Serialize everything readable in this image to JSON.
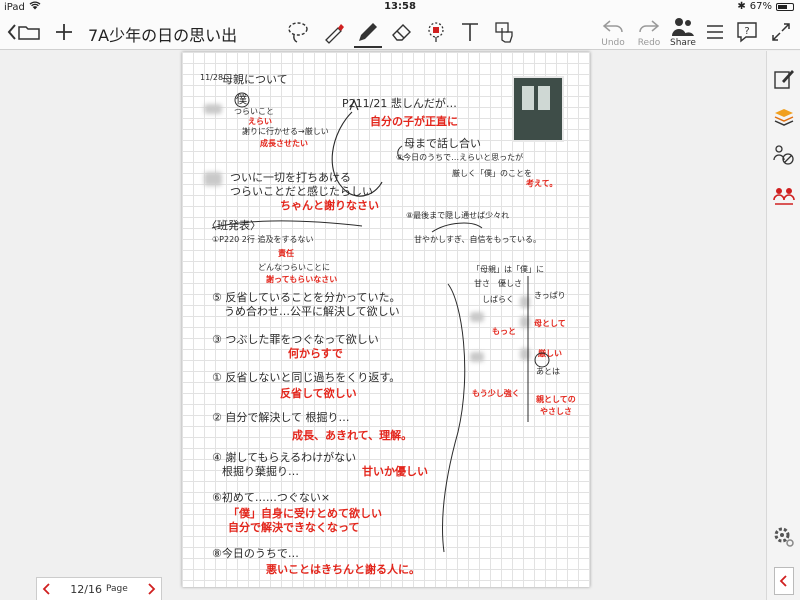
{
  "status": {
    "device": "iPad",
    "time": "13:58",
    "battery": "67%",
    "battery_level": 0.67
  },
  "toolbar": {
    "title": "7A少年の日の思い出",
    "undo_label": "Undo",
    "redo_label": "Redo",
    "share_label": "Share"
  },
  "pagenav": {
    "current": "12/16",
    "label": "Page"
  },
  "note": {
    "date": "11/28",
    "heading": "母親について",
    "lines": [
      {
        "t": "僕",
        "c": "k"
      },
      {
        "t": "つらいこと",
        "c": "ks"
      },
      {
        "t": "えらい",
        "c": "rs"
      },
      {
        "t": "謝りに行かせる→厳しい",
        "c": "ks"
      },
      {
        "t": "成長させたい",
        "c": "rs"
      },
      {
        "t": "P211/21 悲しんだが…",
        "c": "k"
      },
      {
        "t": "自分の子が正直に",
        "c": "r"
      },
      {
        "t": "母まで話し合い",
        "c": "k"
      },
      {
        "t": "⑧今日のうちで…えらいと思ったが",
        "c": "ks"
      },
      {
        "t": "厳しく「僕」のことを",
        "c": "ks"
      },
      {
        "t": "考えて。",
        "c": "rs"
      },
      {
        "t": "ついに一切を打ちあける",
        "c": "k"
      },
      {
        "t": "つらいことだと感じたらしい",
        "c": "k"
      },
      {
        "t": "ちゃんと謝りなさい",
        "c": "r"
      },
      {
        "t": "⑧最後まで隠し通せば少々れ",
        "c": "ks"
      },
      {
        "t": "甘やかしすぎ、自信をもっている。",
        "c": "ks"
      },
      {
        "t": "〈班発表〉",
        "c": "k"
      },
      {
        "t": "①P220 2行 追及をするない",
        "c": "ks"
      },
      {
        "t": "責任",
        "c": "rs"
      },
      {
        "t": "どんなつらいことに",
        "c": "ks"
      },
      {
        "t": "謝ってもらいなさい",
        "c": "rs"
      },
      {
        "t": "⑤ 反省していることを分かっていた。",
        "c": "k"
      },
      {
        "t": "うめ合わせ…公平に解決して欲しい",
        "c": "k"
      },
      {
        "t": "③ つぶした罪をつぐなって欲しい",
        "c": "k"
      },
      {
        "t": "何からすで",
        "c": "r"
      },
      {
        "t": "① 反省しないと同じ過ちをくり返す。",
        "c": "k"
      },
      {
        "t": "反省して欲しい",
        "c": "r"
      },
      {
        "t": "② 自分で解決して 根掘り…",
        "c": "k"
      },
      {
        "t": "成長、あきれて、理解。",
        "c": "r"
      },
      {
        "t": "④ 謝してもらえるわけがない",
        "c": "k"
      },
      {
        "t": "根掘り葉掘り…",
        "c": "k"
      },
      {
        "t": "甘いか優しい",
        "c": "r"
      },
      {
        "t": "⑥初めて……つぐない×",
        "c": "k"
      },
      {
        "t": "「僕」自身に受けとめて欲しい",
        "c": "r"
      },
      {
        "t": "自分で解決できなくなって",
        "c": "r"
      },
      {
        "t": "⑧今日のうちで…",
        "c": "k"
      },
      {
        "t": "悪いことはきちんと謝る人に。",
        "c": "r"
      },
      {
        "t": "「母親」は「僕」に",
        "c": "ks"
      },
      {
        "t": "甘さ　優しさ",
        "c": "ks"
      },
      {
        "t": "しばらく",
        "c": "ks"
      },
      {
        "t": "きっぱり",
        "c": "ks"
      },
      {
        "t": "母として",
        "c": "rs"
      },
      {
        "t": "もっと",
        "c": "rs"
      },
      {
        "t": "厳しい",
        "c": "rs"
      },
      {
        "t": "あとは",
        "c": "ks"
      },
      {
        "t": "もう少し強く",
        "c": "rs"
      },
      {
        "t": "親としての",
        "c": "rs"
      },
      {
        "t": "やさしさ",
        "c": "rs"
      }
    ]
  },
  "colors": {
    "accent": "#d02020",
    "ink": "#2b2b2b",
    "red_ink": "#e3261c"
  },
  "icons": [
    "back-folder-icon",
    "plus-icon",
    "lasso-icon",
    "marker-icon",
    "pen-icon",
    "eraser-icon",
    "shape-select-icon",
    "text-icon",
    "touch-icon",
    "undo-icon",
    "redo-icon",
    "share-icon",
    "list-icon",
    "help-icon",
    "expand-icon"
  ]
}
